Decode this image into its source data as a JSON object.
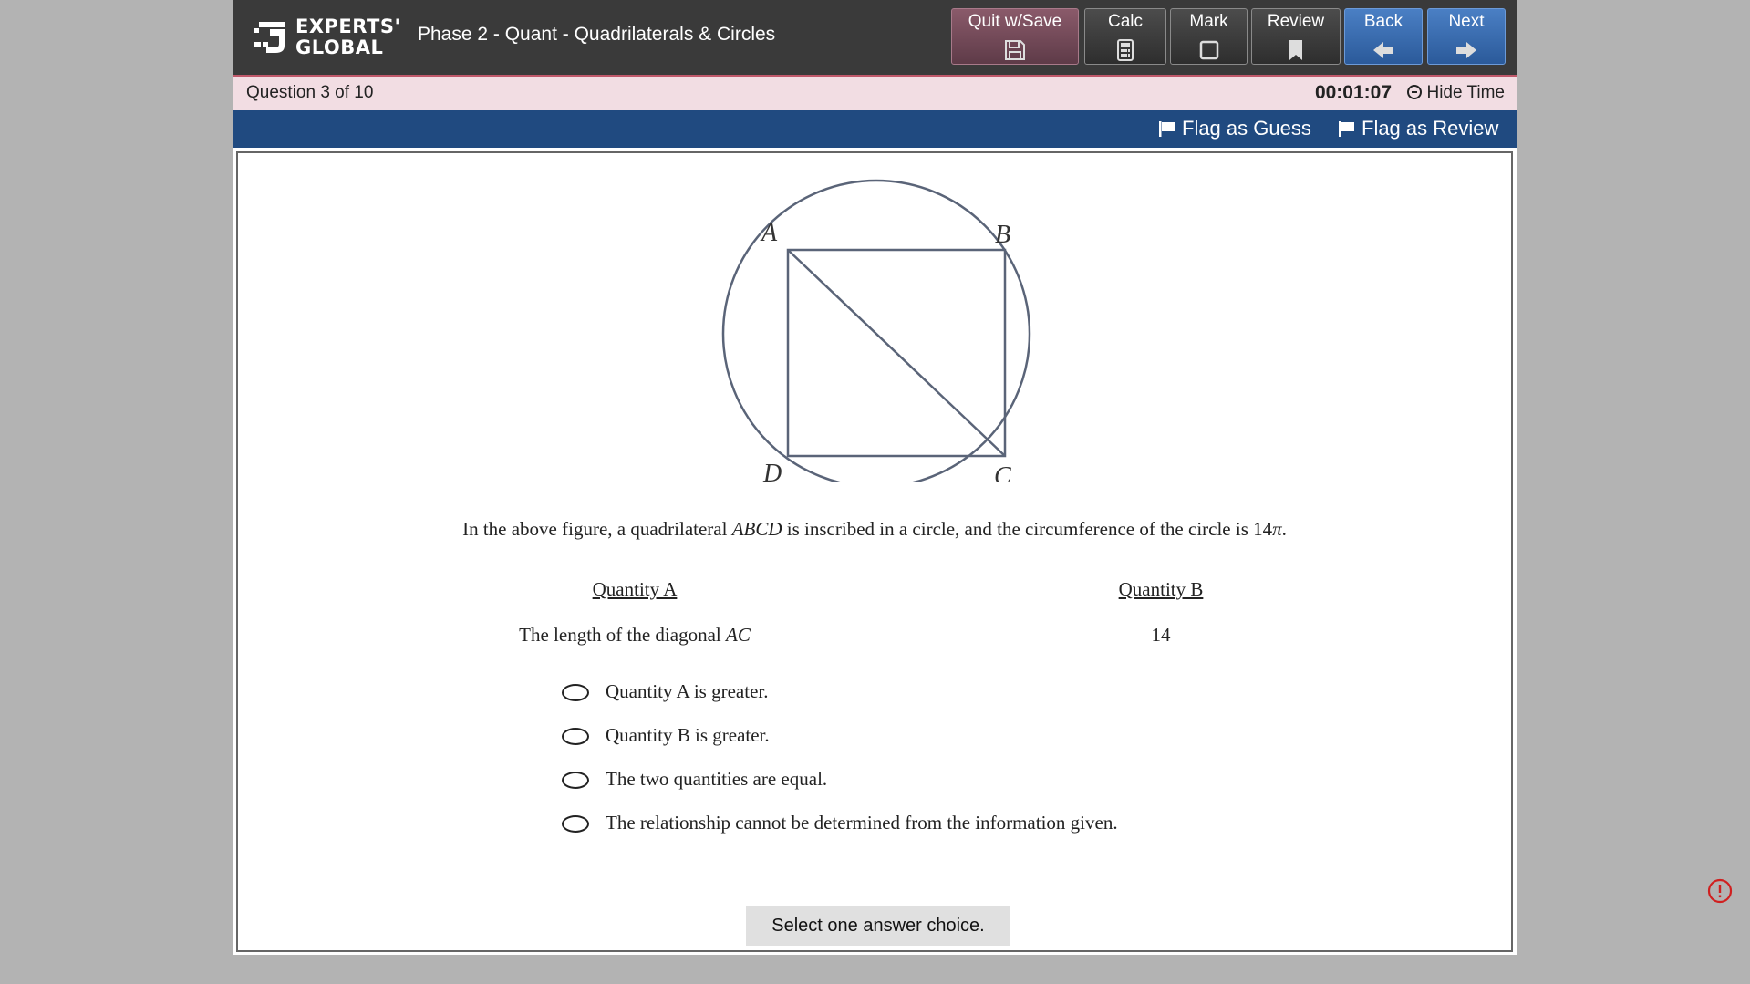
{
  "header": {
    "logo_line1": "EXPERTS'",
    "logo_line2": "GLOBAL",
    "section_title": "Phase 2 - Quant - Quadrilaterals & Circles",
    "buttons": {
      "quit": "Quit w/Save",
      "calc": "Calc",
      "mark": "Mark",
      "review": "Review",
      "back": "Back",
      "next": "Next"
    }
  },
  "status": {
    "question_counter": "Question 3 of 10",
    "timer": "00:01:07",
    "hide_time": "Hide Time"
  },
  "flags": {
    "guess": "Flag as Guess",
    "review": "Flag as Review"
  },
  "figure": {
    "labels": {
      "A": "A",
      "B": "B",
      "C": "C",
      "D": "D"
    }
  },
  "question": {
    "stem_parts": [
      "In the above figure, a quadrilateral ",
      "ABCD",
      " is inscribed in a circle, and the circumference of the circle is 14",
      "π",
      "."
    ],
    "quantity_a_header": "Quantity A",
    "quantity_b_header": "Quantity B",
    "quantity_a_text": "The length of the diagonal ",
    "quantity_a_var": "AC",
    "quantity_b_value": "14",
    "choices": [
      "Quantity A is greater.",
      "Quantity B is greater.",
      "The two quantities are equal.",
      "The relationship cannot be determined from the information given."
    ],
    "hint": "Select one answer choice."
  },
  "colors": {
    "topbar": "#3a3a3a",
    "status_bg": "#f2dde3",
    "flagbar": "#204a80",
    "nav_blue": "#2b5a9a",
    "figure_stroke": "#5a6478"
  }
}
